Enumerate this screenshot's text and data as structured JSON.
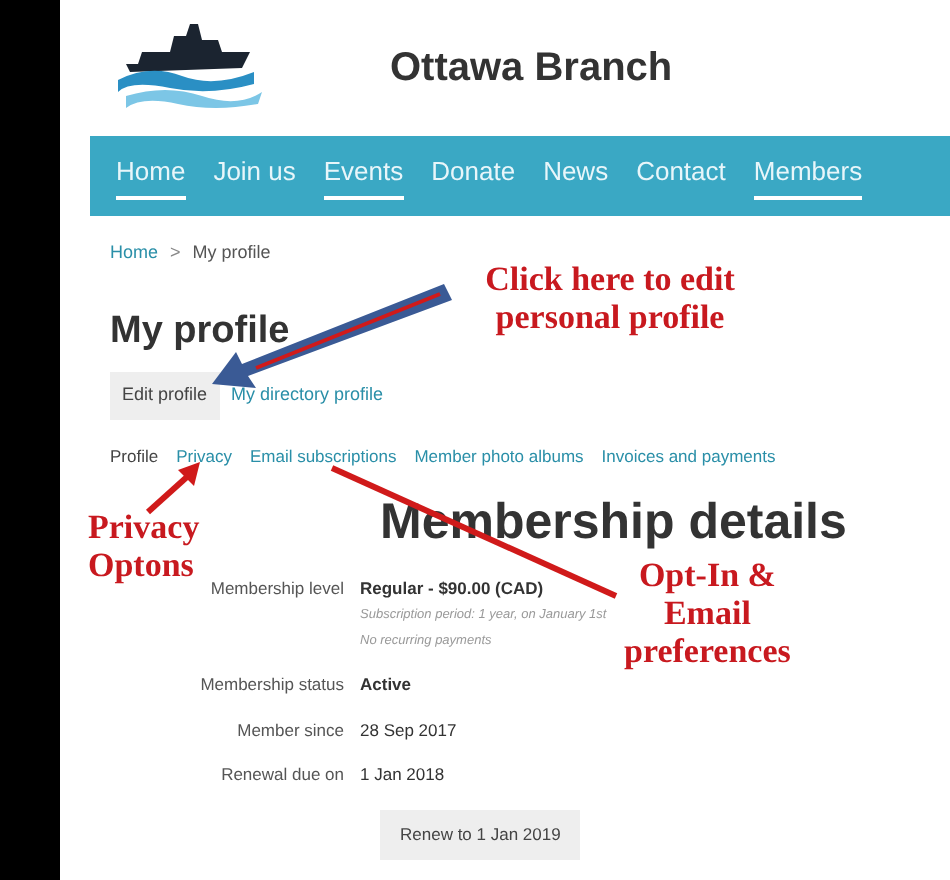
{
  "site": {
    "title": "Ottawa Branch"
  },
  "nav": [
    {
      "label": "Home",
      "underlined": true
    },
    {
      "label": "Join us",
      "underlined": false
    },
    {
      "label": "Events",
      "underlined": true
    },
    {
      "label": "Donate",
      "underlined": false
    },
    {
      "label": "News",
      "underlined": false
    },
    {
      "label": "Contact",
      "underlined": false
    },
    {
      "label": "Members",
      "underlined": true
    }
  ],
  "breadcrumb": {
    "items": [
      "Home",
      "My profile"
    ],
    "separator": ">"
  },
  "page_title": "My profile",
  "actions": [
    {
      "label": "Edit profile",
      "kind": "button"
    },
    {
      "label": "My directory profile",
      "kind": "link"
    }
  ],
  "tabs": [
    {
      "label": "Profile",
      "selected": true
    },
    {
      "label": "Privacy",
      "selected": false
    },
    {
      "label": "Email subscriptions",
      "selected": false
    },
    {
      "label": "Member photo albums",
      "selected": false
    },
    {
      "label": "Invoices and payments",
      "selected": false
    }
  ],
  "membership": {
    "heading": "Membership details",
    "rows": [
      {
        "label": "Membership level",
        "value": "Regular - $90.00 (CAD)",
        "notes": [
          "Subscription period: 1 year, on January 1st",
          "No recurring payments"
        ]
      },
      {
        "label": "Membership status",
        "value": "Active",
        "notes": []
      },
      {
        "label": "Member since",
        "value": "28 Sep 2017",
        "notes": []
      },
      {
        "label": "Renewal due on",
        "value": "1 Jan 2018",
        "notes": []
      }
    ],
    "renew_button": "Renew to 1 Jan 2019"
  },
  "annotations": [
    {
      "kind": "edit",
      "lines": [
        "Click here to edit",
        "personal profile"
      ]
    },
    {
      "kind": "privacy",
      "lines": [
        "Privacy",
        "Optons"
      ]
    },
    {
      "kind": "email",
      "lines": [
        "Opt-In &",
        "Email",
        "preferences"
      ]
    }
  ]
}
